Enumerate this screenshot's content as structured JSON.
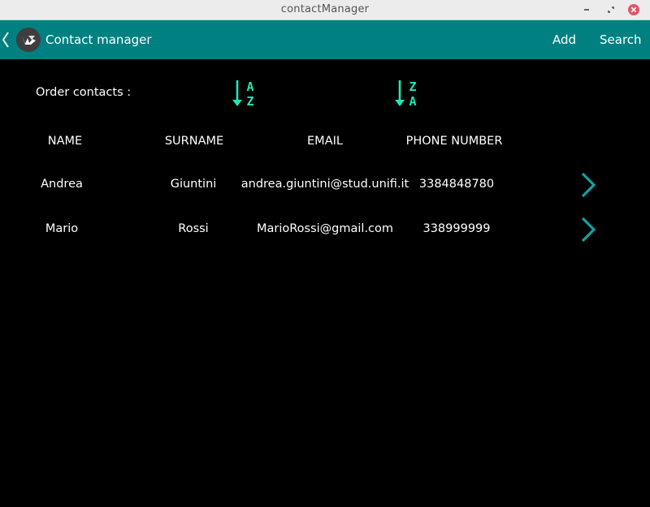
{
  "window": {
    "title": "contactManager",
    "controls": [
      "minimize-icon",
      "maximize-icon",
      "close-icon"
    ],
    "close_color": "#e0556a"
  },
  "appbar": {
    "title": "Contact manager",
    "color": "#008080",
    "actions": {
      "add": "Add",
      "search": "Search"
    }
  },
  "order": {
    "label": "Order contacts  :",
    "az": {
      "top": "A",
      "bottom": "Z"
    },
    "za": {
      "top": "Z",
      "bottom": "A"
    },
    "accent": "#1de9b6"
  },
  "table": {
    "headers": {
      "name": "NAME",
      "surname": "SURNAME",
      "email": "EMAIL",
      "phone": "PHONE NUMBER"
    },
    "rows": [
      {
        "name": "Andrea",
        "surname": "Giuntini",
        "email": "andrea.giuntini@stud.unifi.it",
        "phone": "3384848780"
      },
      {
        "name": "Mario",
        "surname": "Rossi",
        "email": "MarioRossi@gmail.com",
        "phone": "338999999"
      }
    ],
    "row_action_icon": "chevron-right-icon",
    "row_action_color": "#16a0a0"
  }
}
